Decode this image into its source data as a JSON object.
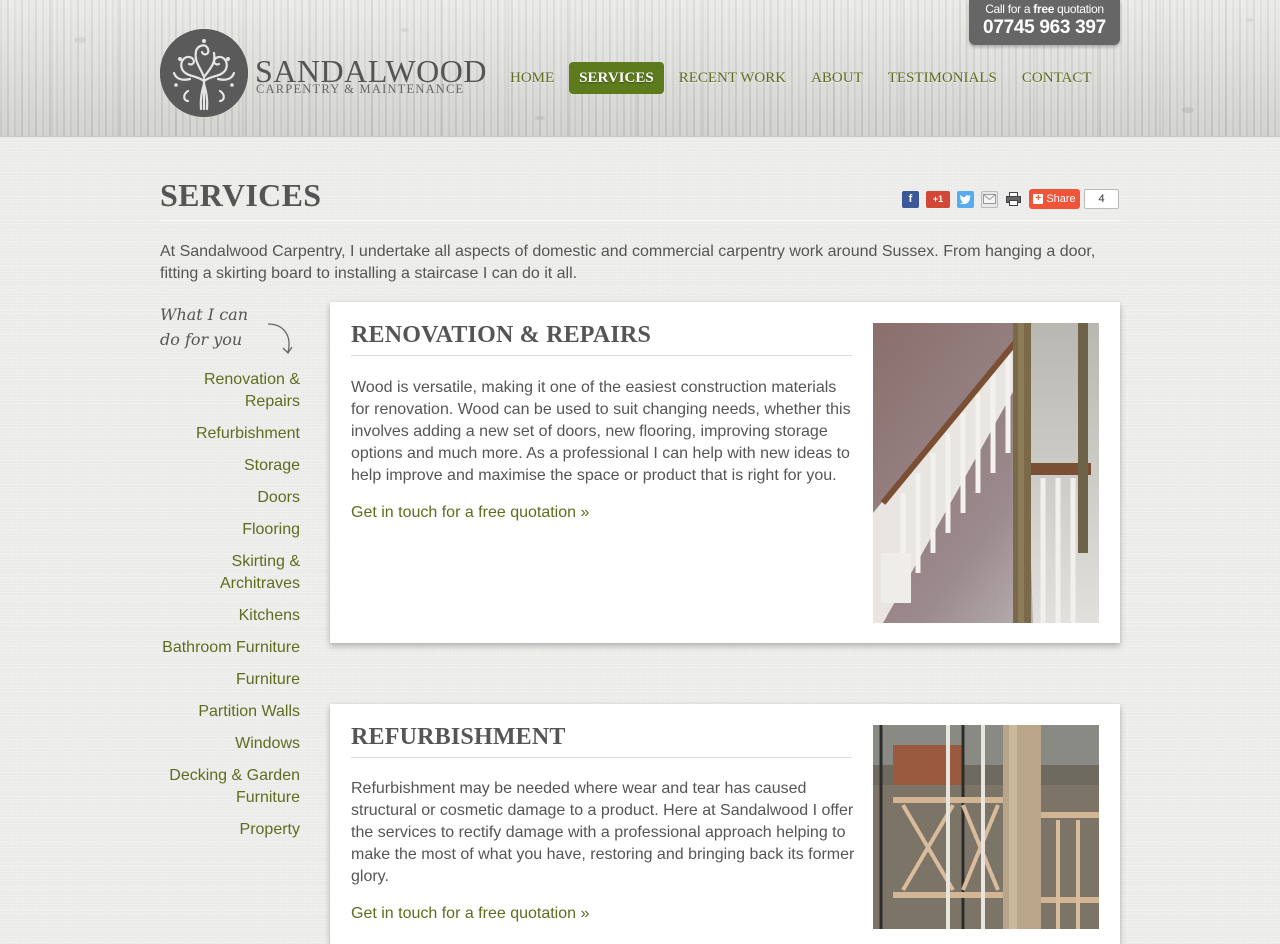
{
  "header": {
    "logo": {
      "name": "SANDALWOOD",
      "tagline": "CARPENTRY & MAINTENANCE"
    },
    "phone": {
      "label_pre": "Call for a ",
      "label_bold": "free",
      "label_post": " quotation",
      "number": "07745 963 397"
    },
    "nav": [
      {
        "label": "HOME",
        "active": false
      },
      {
        "label": "SERVICES",
        "active": true
      },
      {
        "label": "RECENT WORK",
        "active": false
      },
      {
        "label": "ABOUT",
        "active": false
      },
      {
        "label": "TESTIMONIALS",
        "active": false
      },
      {
        "label": "CONTACT",
        "active": false
      }
    ]
  },
  "page": {
    "title": "SERVICES",
    "intro": "At Sandalwood Carpentry, I undertake all aspects of domestic and commercial carpentry work around Sussex. From hanging a door, fitting a skirting board to installing a staircase I can do it all."
  },
  "share": {
    "gplus": "+1",
    "share_label": "Share",
    "count": "4"
  },
  "sidebar": {
    "note_line1": "What I can",
    "note_line2": "do for you",
    "items": [
      "Renovation & Repairs",
      "Refurbishment",
      "Storage",
      "Doors",
      "Flooring",
      "Skirting & Architraves",
      "Kitchens",
      "Bathroom Furniture",
      "Furniture",
      "Partition Walls",
      "Windows",
      "Decking & Garden Furniture",
      "Property"
    ]
  },
  "services": [
    {
      "title": "RENOVATION & REPAIRS",
      "text": "Wood is versatile, making it one of the easiest construction materials for renovation. Wood can be used to suit changing needs, whether this involves adding a new set of doors, new flooring, improving storage options and much more. As a professional I can help with new ideas to help improve and maximise the space or product that is right for you.",
      "link": "Get in touch for a free quotation »"
    },
    {
      "title": "REFURBISHMENT",
      "text": "Refurbishment may be needed where wear and tear has caused structural or cosmetic damage to a product. Here at Sandalwood I offer the services to rectify damage with a professional approach helping to make the most of what you have, restoring and bringing back its former glory.",
      "link": "Get in touch for a free quotation »"
    }
  ],
  "colors": {
    "accent": "#5d7a1d",
    "link": "#5d6d1e",
    "text": "#555555"
  }
}
